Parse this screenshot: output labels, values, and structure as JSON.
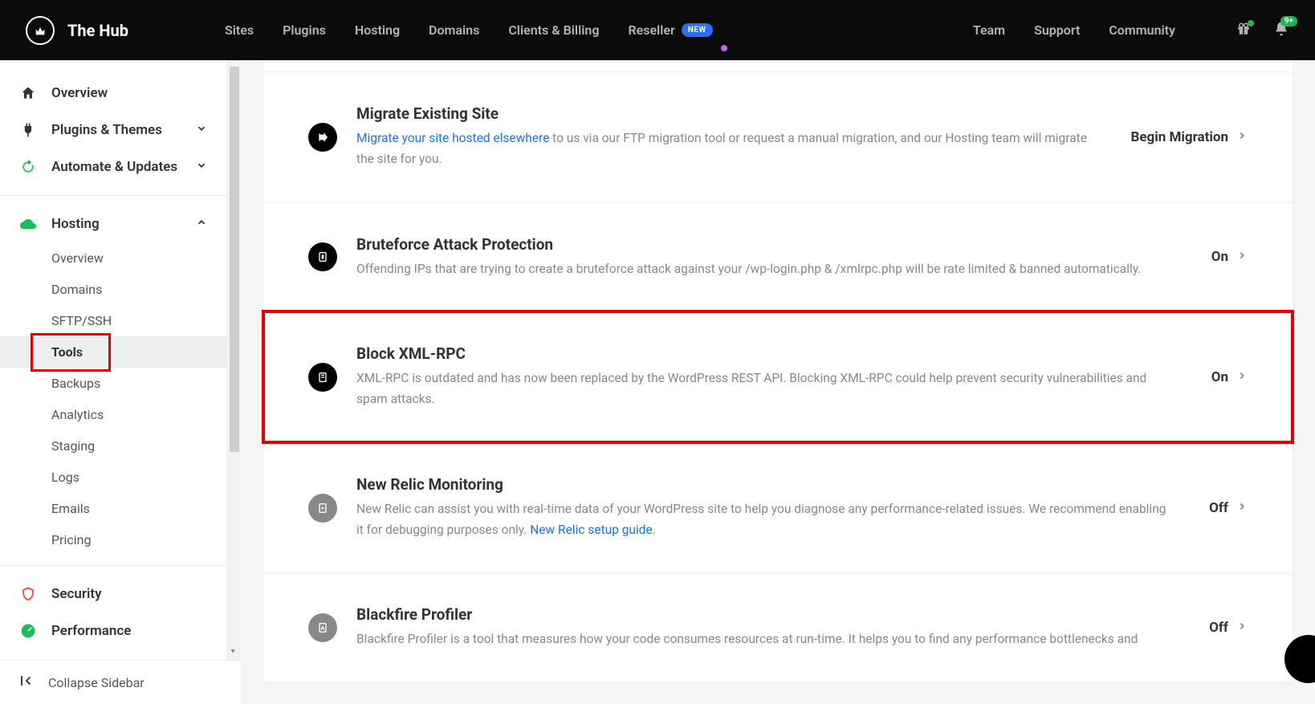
{
  "app_title": "The Hub",
  "topnav": {
    "sites": "Sites",
    "plugins": "Plugins",
    "hosting": "Hosting",
    "domains": "Domains",
    "clients_billing": "Clients & Billing",
    "reseller": "Reseller",
    "new_badge": "NEW"
  },
  "topnav_right": {
    "team": "Team",
    "support": "Support",
    "community": "Community",
    "bell_badge": "9+"
  },
  "sidebar": {
    "overview": "Overview",
    "plugins_themes": "Plugins & Themes",
    "automate_updates": "Automate & Updates",
    "hosting": "Hosting",
    "hosting_sub": {
      "overview": "Overview",
      "domains": "Domains",
      "sftp_ssh": "SFTP/SSH",
      "tools": "Tools",
      "backups": "Backups",
      "analytics": "Analytics",
      "staging": "Staging",
      "logs": "Logs",
      "emails": "Emails",
      "pricing": "Pricing"
    },
    "security": "Security",
    "performance": "Performance",
    "collapse": "Collapse Sidebar"
  },
  "tools": {
    "migrate": {
      "title": "Migrate Existing Site",
      "link": "Migrate your site hosted elsewhere",
      "desc": " to us via our FTP migration tool or request a manual migration, and our Hosting team will migrate the site for you.",
      "action": "Begin Migration"
    },
    "bruteforce": {
      "title": "Bruteforce Attack Protection",
      "desc": "Offending IPs that are trying to create a bruteforce attack against your /wp-login.php & /xmlrpc.php will be rate limited & banned automatically.",
      "action": "On"
    },
    "xmlrpc": {
      "title": "Block XML-RPC",
      "desc": "XML-RPC is outdated and has now been replaced by the WordPress REST API. Blocking XML-RPC could help prevent security vulnerabilities and spam attacks.",
      "action": "On"
    },
    "newrelic": {
      "title": "New Relic Monitoring",
      "desc_pre": "New Relic can assist you with real-time data of your WordPress site to help you diagnose any performance-related issues. We recommend enabling it for debugging purposes only. ",
      "link": "New Relic setup guide",
      "desc_post": ".",
      "action": "Off"
    },
    "blackfire": {
      "title": "Blackfire Profiler",
      "desc": "Blackfire Profiler is a tool that measures how your code consumes resources at run-time. It helps you to find any performance bottlenecks and",
      "action": "Off"
    }
  }
}
